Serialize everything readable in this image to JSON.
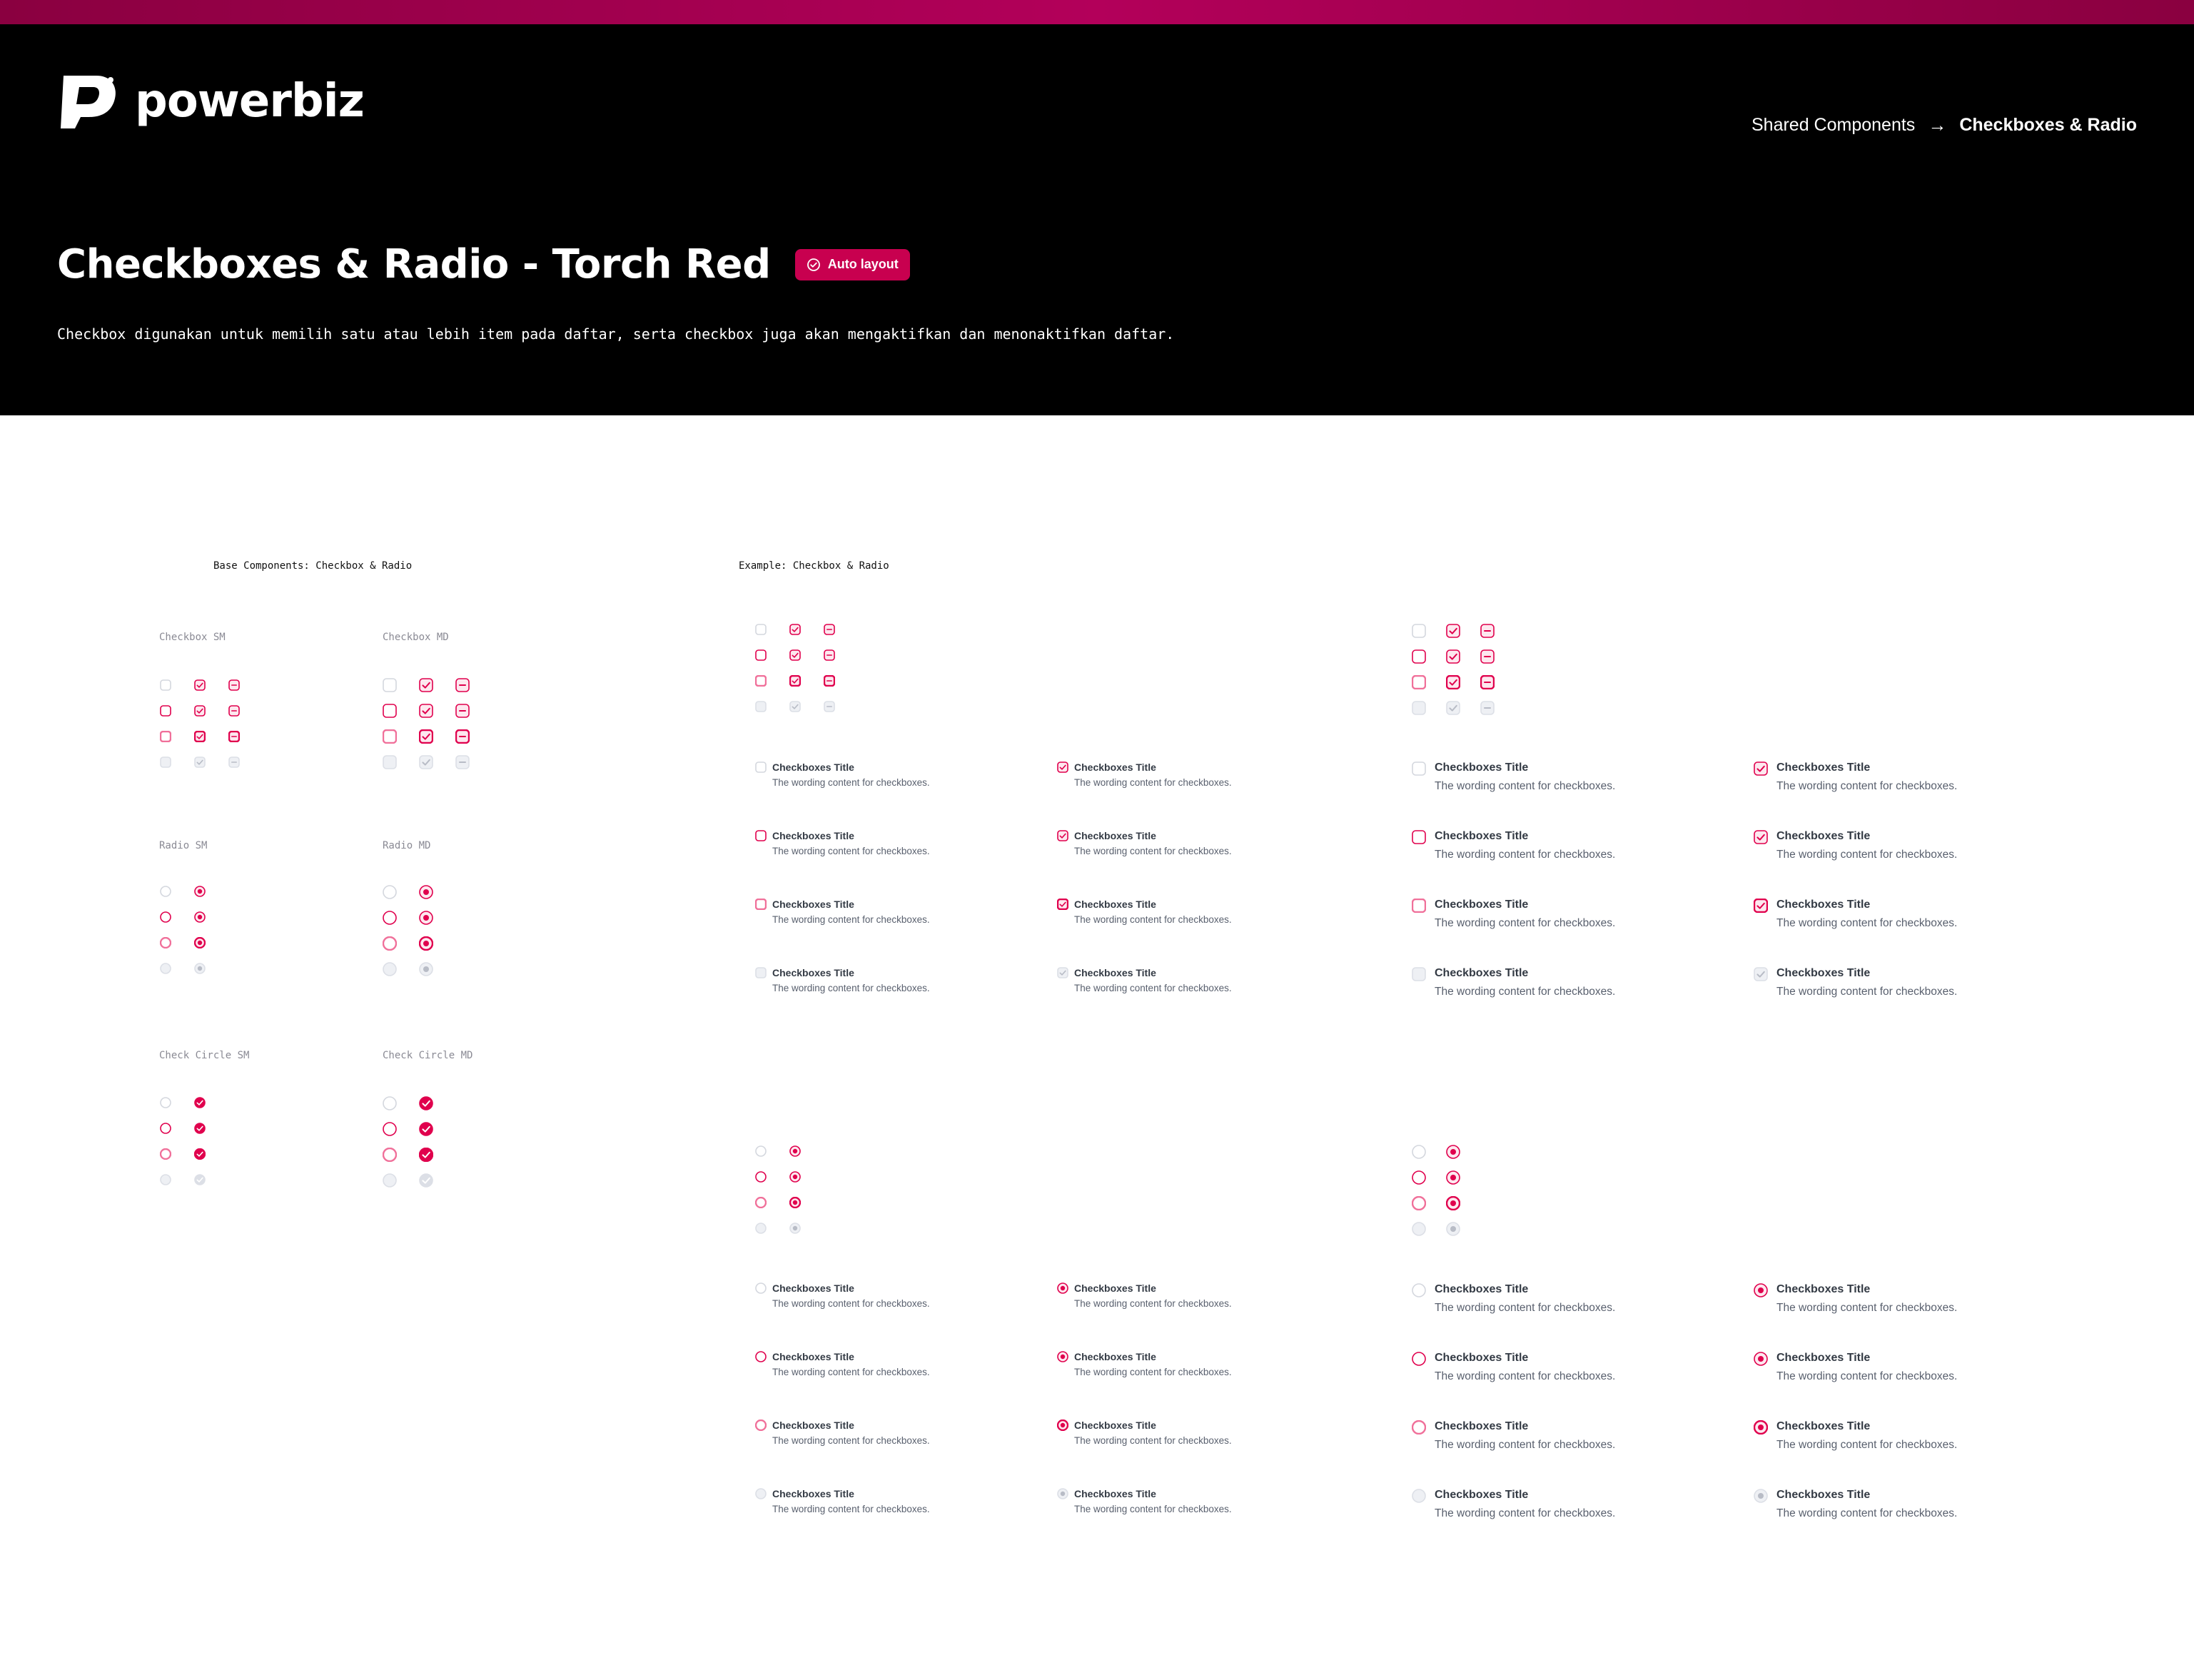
{
  "brand": {
    "name": "powerbiz"
  },
  "breadcrumb": {
    "parent": "Shared Components",
    "separator": "→",
    "current": "Checkboxes & Radio"
  },
  "page": {
    "title": "Checkboxes & Radio - Torch Red",
    "badge": "Auto layout",
    "subtitle": "Checkbox digunakan untuk memilih satu atau lebih item pada daftar, serta checkbox juga akan mengaktifkan dan menonaktifkan daftar."
  },
  "sections": {
    "base": "Base Components: Checkbox & Radio",
    "example": "Example: Checkbox & Radio"
  },
  "groups": {
    "checkbox_sm": "Checkbox SM",
    "checkbox_md": "Checkbox MD",
    "radio_sm": "Radio SM",
    "radio_md": "Radio MD",
    "check_circle_sm": "Check Circle SM",
    "check_circle_md": "Check Circle MD"
  },
  "item": {
    "title": "Checkboxes Title",
    "description": "The wording content for checkboxes."
  },
  "icons": {
    "logo": "powerbiz-logo-icon",
    "badge": "check-circle-icon",
    "checkbox": "checkbox-icon",
    "radio": "radio-icon",
    "check_circle": "check-circle-icon"
  },
  "colors": {
    "accent": "#e0004d",
    "accent_border": "#f0709a",
    "accent_fill": "#fde8ef",
    "disabled_fill": "#eef0f4",
    "disabled_border": "#dcdfe6",
    "disabled_mark": "#b8bcc6",
    "idle_border": "#d4d7de",
    "badge": "#c8004f"
  }
}
